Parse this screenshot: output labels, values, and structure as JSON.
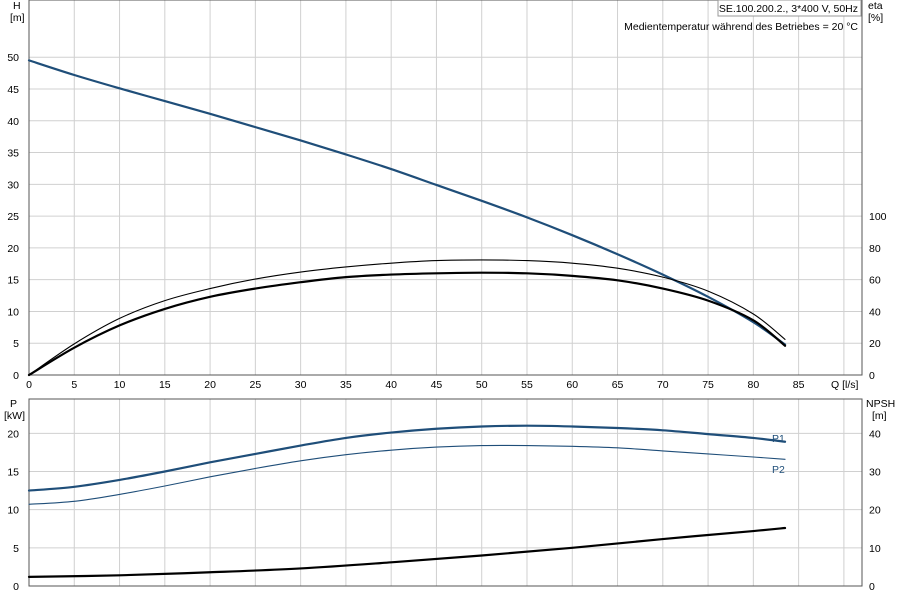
{
  "chart_data": [
    {
      "type": "line",
      "panel": "top",
      "title_box": "SE.100.200.2., 3*400 V, 50Hz",
      "note": "Medientemperatur während des Betriebes = 20 °C",
      "xlabel": "Q [l/s]",
      "ylabel_left": [
        "H",
        "[m]"
      ],
      "ylabel_right": [
        "eta",
        "[%]"
      ],
      "xlim": [
        0,
        92
      ],
      "ylim_left": [
        0,
        59
      ],
      "ylim_right": [
        0,
        236
      ],
      "grid": true,
      "x_ticks": [
        "0",
        "5",
        "10",
        "15",
        "20",
        "25",
        "30",
        "35",
        "40",
        "45",
        "50",
        "55",
        "60",
        "65",
        "70",
        "75",
        "80",
        "85"
      ],
      "y_ticks_left": [
        "0",
        "5",
        "10",
        "15",
        "20",
        "25",
        "30",
        "35",
        "40",
        "45",
        "50"
      ],
      "y_ticks_right": [
        "0",
        "20",
        "40",
        "60",
        "80",
        "100"
      ],
      "series": [
        {
          "axis": "left",
          "color": "#1f4e79",
          "width": 2.2,
          "x": [
            0,
            5,
            10,
            15,
            20,
            25,
            30,
            35,
            40,
            45,
            50,
            55,
            60,
            65,
            70,
            75,
            80,
            83.5
          ],
          "y": [
            49.5,
            47.2,
            45.1,
            43.1,
            41.1,
            39.0,
            36.9,
            34.7,
            32.4,
            29.9,
            27.4,
            24.8,
            22.0,
            19.0,
            15.8,
            12.3,
            8.3,
            4.8
          ]
        },
        {
          "axis": "right",
          "color": "#000000",
          "width": 1.1,
          "x": [
            0,
            5,
            10,
            15,
            20,
            25,
            30,
            35,
            40,
            45,
            50,
            55,
            60,
            65,
            70,
            75,
            80,
            83.5
          ],
          "y": [
            0,
            19.6,
            35.6,
            46.8,
            54.4,
            60.4,
            64.8,
            68.0,
            70.4,
            72.0,
            72.4,
            72.0,
            70.4,
            67.2,
            61.6,
            52.8,
            38.4,
            22.4
          ]
        },
        {
          "axis": "right",
          "color": "#000000",
          "width": 2.2,
          "x": [
            0,
            5,
            10,
            15,
            20,
            25,
            30,
            35,
            40,
            45,
            50,
            55,
            60,
            65,
            70,
            75,
            80,
            83.5
          ],
          "y": [
            0,
            17.2,
            31.2,
            41.6,
            49.2,
            54.4,
            58.4,
            61.6,
            63.2,
            64.0,
            64.4,
            64.0,
            62.4,
            59.6,
            54.4,
            46.8,
            34.4,
            18.4
          ]
        }
      ]
    },
    {
      "type": "line",
      "panel": "bottom",
      "ylabel_left": [
        "P",
        "[kW]"
      ],
      "ylabel_right": [
        "NPSH",
        "[m]"
      ],
      "xlim": [
        0,
        92
      ],
      "ylim_left": [
        0,
        24.5
      ],
      "ylim_right": [
        0,
        49
      ],
      "grid": true,
      "y_ticks_left": [
        "0",
        "5",
        "10",
        "15",
        "20"
      ],
      "y_ticks_right": [
        "0",
        "10",
        "20",
        "30",
        "40"
      ],
      "series": [
        {
          "name": "P1",
          "axis": "left",
          "color": "#1f4e79",
          "width": 2.2,
          "x": [
            0,
            5,
            10,
            15,
            20,
            25,
            30,
            35,
            40,
            45,
            50,
            55,
            60,
            65,
            70,
            75,
            80,
            83.5
          ],
          "y": [
            12.5,
            13.0,
            13.9,
            15.0,
            16.2,
            17.3,
            18.4,
            19.4,
            20.1,
            20.6,
            20.9,
            21.0,
            20.9,
            20.7,
            20.4,
            19.9,
            19.4,
            18.9
          ]
        },
        {
          "name": "P2",
          "axis": "left",
          "color": "#1f4e79",
          "width": 1.1,
          "x": [
            0,
            5,
            10,
            15,
            20,
            25,
            30,
            35,
            40,
            45,
            50,
            55,
            60,
            65,
            70,
            75,
            80,
            83.5
          ],
          "y": [
            10.7,
            11.1,
            12.0,
            13.1,
            14.3,
            15.4,
            16.4,
            17.2,
            17.8,
            18.2,
            18.4,
            18.4,
            18.3,
            18.1,
            17.7,
            17.3,
            16.9,
            16.6
          ]
        },
        {
          "axis": "right",
          "color": "#000000",
          "width": 2.2,
          "x": [
            0,
            10,
            20,
            30,
            40,
            50,
            60,
            70,
            80,
            83.5
          ],
          "y": [
            2.4,
            2.8,
            3.6,
            4.6,
            6.2,
            8.0,
            10.0,
            12.3,
            14.4,
            15.2
          ]
        }
      ]
    }
  ]
}
